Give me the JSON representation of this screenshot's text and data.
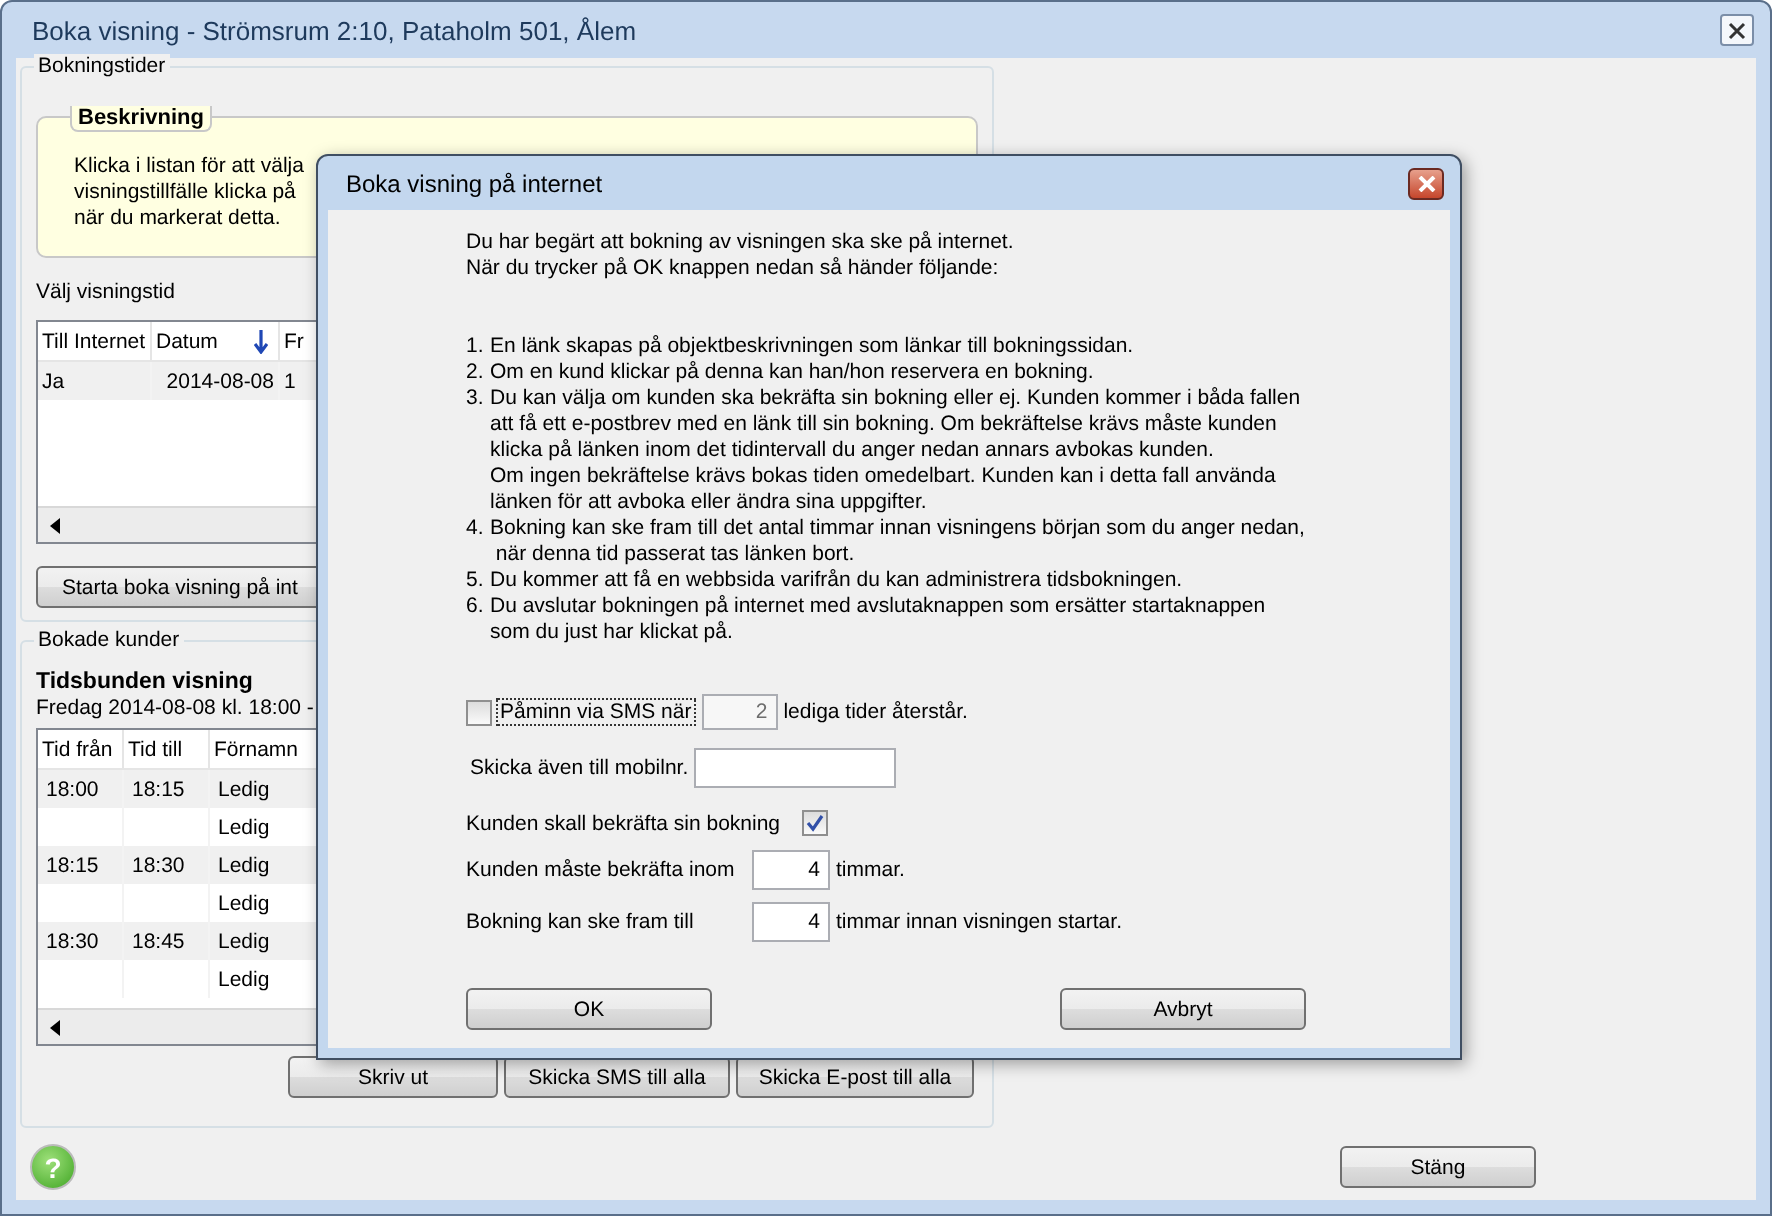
{
  "window": {
    "title": "Boka visning - Strömsrum 2:10, Pataholm 501, Ålem"
  },
  "booking_times": {
    "title": "Bokningstider",
    "description": {
      "title": "Beskrivning",
      "lines": [
        "Klicka i listan för att välja",
        "visningstillfälle klicka på",
        "när du markerat detta."
      ]
    },
    "list_label": "Välj visningstid",
    "table": {
      "columns": [
        {
          "label": "Till Internet"
        },
        {
          "label": "Datum",
          "sorted": true
        },
        {
          "label": "Fr"
        }
      ],
      "rows": [
        [
          "Ja",
          "2014-08-08",
          "1"
        ]
      ]
    },
    "start_button": "Starta boka visning på int"
  },
  "booked_customers": {
    "title": "Bokade kunder",
    "heading": "Tidsbunden visning",
    "subheading": "Fredag 2014-08-08 kl. 18:00 -",
    "table": {
      "columns": [
        "Tid från",
        "Tid till",
        "Förnamn"
      ],
      "rows": [
        [
          "18:00",
          "18:15",
          "Ledig"
        ],
        [
          "",
          "",
          "Ledig"
        ],
        [
          "18:15",
          "18:30",
          "Ledig"
        ],
        [
          "",
          "",
          "Ledig"
        ],
        [
          "18:30",
          "18:45",
          "Ledig"
        ],
        [
          "",
          "",
          "Ledig"
        ]
      ]
    },
    "buttons": [
      "Skriv ut",
      "Skicka SMS till alla",
      "Skicka E-post till alla"
    ]
  },
  "help_glyph": "?",
  "close_button": "Stäng",
  "dialog": {
    "title": "Boka visning på internet",
    "intro": [
      "Du har begärt att bokning av visningen ska ske på internet.",
      "När du trycker på OK knappen nedan så händer följande:"
    ],
    "steps": [
      {
        "number": "1.",
        "lines": [
          "En länk skapas på objektbeskrivningen som länkar till bokningssidan."
        ]
      },
      {
        "number": "2.",
        "lines": [
          "Om en kund klickar på denna kan han/hon reservera en bokning."
        ]
      },
      {
        "number": "3.",
        "lines": [
          "Du kan välja om kunden ska bekräfta sin bokning eller ej. Kunden kommer i båda fallen",
          "att få ett e-postbrev med en länk till sin bokning. Om bekräftelse krävs måste kunden",
          "klicka på länken inom det tidintervall du anger nedan annars avbokas kunden.",
          "Om ingen bekräftelse krävs bokas tiden omedelbart. Kunden kan i detta fall använda",
          "länken för att avboka eller ändra sina uppgifter."
        ]
      },
      {
        "number": "4.",
        "lines": [
          "Bokning kan ske fram till det antal timmar innan visningens början som du anger nedan,",
          " när denna tid passerat tas länken bort."
        ]
      },
      {
        "number": "5.",
        "lines": [
          "Du kommer att få en webbsida varifrån du kan administrera tidsbokningen."
        ]
      },
      {
        "number": "6.",
        "lines": [
          "Du avslutar bokningen på internet med avslutaknappen som ersätter startaknappen",
          "som du just har klickat på."
        ]
      }
    ],
    "sms_reminder": {
      "label": "Påminn via SMS när",
      "checked": false,
      "value": "2",
      "value_disabled": true,
      "suffix": "lediga tider återstår."
    },
    "mobile": {
      "label": "Skicka även till mobilnr."
    },
    "confirm": {
      "label": "Kunden skall bekräfta sin bokning",
      "checked": true
    },
    "confirm_within": {
      "label": "Kunden måste bekräfta inom",
      "value": "4",
      "suffix": "timmar."
    },
    "book_until": {
      "label": "Bokning kan ske fram till",
      "value": "4",
      "suffix": "timmar innan visningen startar."
    },
    "buttons": [
      "OK",
      "Avbryt"
    ]
  }
}
